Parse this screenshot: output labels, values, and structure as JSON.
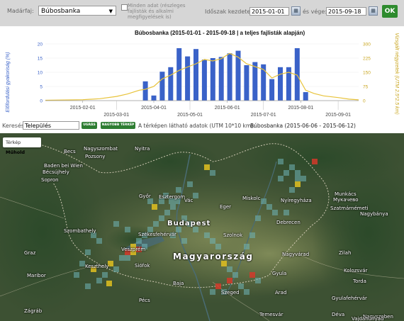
{
  "filter": {
    "species_label": "Madárfaj:",
    "species_value": "Búbosbanka",
    "all_data_label": "Minden adat (részleges fajlisták és alkalmi megfigyelések is)",
    "start_label": "Időszak kezdete:",
    "start_value": "2015-01-01",
    "end_label": "és vége:",
    "end_value": "2015-09-18",
    "ok_label": "OK"
  },
  "colors": {
    "bar": "#3a62c8",
    "line": "#e8c33a",
    "ok": "#2e8b2e"
  },
  "chart_data": {
    "type": "bar",
    "title": "Búbosbanka (2015-01-01 - 2015-09-18 | a teljes fajlisták alapján)",
    "ylabel": "Előfordulási gyakoriság (%)",
    "y2label": "Vizsgált négyzetek (UTM 2.5*2.5 km)",
    "ylim": [
      0,
      20
    ],
    "y2lim": [
      0,
      300
    ],
    "yticks": [
      "0",
      "5",
      "10",
      "15",
      "20"
    ],
    "y2ticks": [
      "0",
      "75",
      "150",
      "225",
      "300"
    ],
    "xticks_top": [
      "2015-02-01",
      "2015-04-01",
      "2015-06-01",
      "2015-08-01"
    ],
    "xticks_bottom": [
      "2015-03-01",
      "2015-05-01",
      "2015-07-01",
      "2015-09-01"
    ],
    "x": [
      "2015-03-25",
      "2015-04-01",
      "2015-04-08",
      "2015-04-15",
      "2015-04-22",
      "2015-04-29",
      "2015-05-06",
      "2015-05-13",
      "2015-05-20",
      "2015-05-27",
      "2015-06-03",
      "2015-06-10",
      "2015-06-17",
      "2015-06-24",
      "2015-07-01",
      "2015-07-08",
      "2015-07-15",
      "2015-07-22",
      "2015-07-29",
      "2015-08-05"
    ],
    "values": [
      6.8,
      1.8,
      10.2,
      11.8,
      18.5,
      15.6,
      18.2,
      14.5,
      15.0,
      15.4,
      16.7,
      17.6,
      12.5,
      13.6,
      12.8,
      7.6,
      11.8,
      11.8,
      18.5,
      3.0
    ],
    "line_x": [
      "2015-01-01",
      "2015-02-01",
      "2015-02-15",
      "2015-03-01",
      "2015-03-10",
      "2015-03-20",
      "2015-03-25",
      "2015-04-01",
      "2015-04-08",
      "2015-04-15",
      "2015-04-22",
      "2015-04-29",
      "2015-05-06",
      "2015-05-13",
      "2015-05-20",
      "2015-05-27",
      "2015-06-03",
      "2015-06-10",
      "2015-06-17",
      "2015-06-24",
      "2015-07-01",
      "2015-07-08",
      "2015-07-15",
      "2015-07-22",
      "2015-07-29",
      "2015-08-05",
      "2015-08-12",
      "2015-08-20",
      "2015-09-01",
      "2015-09-10",
      "2015-09-18"
    ],
    "line_values": [
      2,
      5,
      10,
      22,
      35,
      55,
      60,
      75,
      115,
      135,
      160,
      178,
      195,
      218,
      210,
      222,
      250,
      230,
      195,
      180,
      165,
      120,
      140,
      150,
      135,
      55,
      38,
      25,
      16,
      8,
      4
    ]
  },
  "search": {
    "label": "Keresés:",
    "placeholder": "Település",
    "jump_label": "UGRÁS",
    "bigmap_label": "NAGYOBB TÉRKÉP",
    "info_prefix": "A térképen látható adatok (UTM 10*10 km):",
    "info_value": "Búbosbanka (2015-06-06 - 2015-06-12)"
  },
  "map": {
    "type_map": "Térkép",
    "type_satellite": "Műhold",
    "cities": [
      {
        "name": "Nagyszombat",
        "cls": ""
      },
      {
        "name": "Nyitra",
        "cls": ""
      },
      {
        "name": "Becs",
        "cls": ""
      },
      {
        "name": "Pozsony",
        "cls": ""
      },
      {
        "name": "Baden bei Wien",
        "cls": ""
      },
      {
        "name": "Bécsújhely",
        "cls": ""
      },
      {
        "name": "Sopron",
        "cls": ""
      },
      {
        "name": "Győr",
        "cls": ""
      },
      {
        "name": "Esztergom",
        "cls": ""
      },
      {
        "name": "Vác",
        "cls": ""
      },
      {
        "name": "Eger",
        "cls": ""
      },
      {
        "name": "Miskolc",
        "cls": ""
      },
      {
        "name": "Nyíregyháza",
        "cls": ""
      },
      {
        "name": "Munkács",
        "cls": ""
      },
      {
        "name": "Мукачево",
        "cls": ""
      },
      {
        "name": "Szatmárnémeti",
        "cls": ""
      },
      {
        "name": "Nagybánya",
        "cls": ""
      },
      {
        "name": "Budapest",
        "cls": "big"
      },
      {
        "name": "Debrecen",
        "cls": ""
      },
      {
        "name": "Szombathely",
        "cls": ""
      },
      {
        "name": "Székesfehérvár",
        "cls": ""
      },
      {
        "name": "Szolnok",
        "cls": ""
      },
      {
        "name": "Graz",
        "cls": ""
      },
      {
        "name": "Veszprém",
        "cls": ""
      },
      {
        "name": "Magyarország",
        "cls": "country"
      },
      {
        "name": "Nagyvárad",
        "cls": ""
      },
      {
        "name": "Zilah",
        "cls": ""
      },
      {
        "name": "Keszthely",
        "cls": ""
      },
      {
        "name": "Siófok",
        "cls": ""
      },
      {
        "name": "Kolozsvár",
        "cls": ""
      },
      {
        "name": "Maribor",
        "cls": ""
      },
      {
        "name": "Gyula",
        "cls": ""
      },
      {
        "name": "Torda",
        "cls": ""
      },
      {
        "name": "Baja",
        "cls": ""
      },
      {
        "name": "Szeged",
        "cls": ""
      },
      {
        "name": "Arad",
        "cls": ""
      },
      {
        "name": "Pécs",
        "cls": ""
      },
      {
        "name": "Gyulafehérvár",
        "cls": ""
      },
      {
        "name": "Zágráb",
        "cls": ""
      },
      {
        "name": "Temesvár",
        "cls": ""
      },
      {
        "name": "Déva",
        "cls": ""
      },
      {
        "name": "Nagyszeben",
        "cls": ""
      },
      {
        "name": "Vajdahunyad",
        "cls": ""
      }
    ],
    "cell_colors": {
      "low": "#6fb5b8",
      "mid": "#e0c020",
      "high": "#d23a2a"
    }
  }
}
